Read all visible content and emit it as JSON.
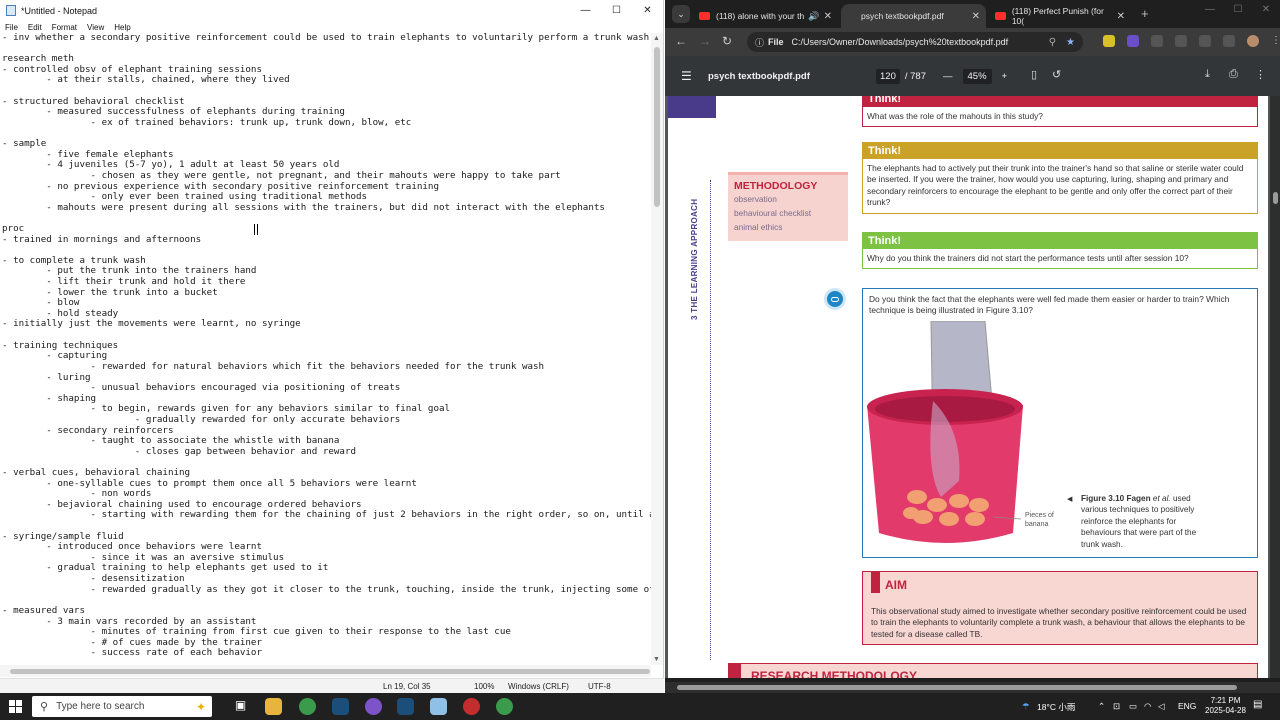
{
  "notepad": {
    "title": "*Untitled - Notepad",
    "menu": [
      "File",
      "Edit",
      "Format",
      "View",
      "Help"
    ],
    "lines": [
      "- inv whether a secondary positive reinforcement could be used to train elephants to voluntarily perform a trunk wash",
      "",
      "research meth",
      "- controlled obsv of elephant training sessions",
      "        - at their stalls, chained, where they lived",
      "",
      "- structured behavioral checklist",
      "        - measured successfulness of elephants during training",
      "                - ex of trained behaviors: trunk up, trunk down, blow, etc",
      "",
      "- sample",
      "        - five female elephants",
      "        - 4 juveniles (5-7 yo), 1 adult at least 50 years old",
      "                - chosen as they were gentle, not pregnant, and their mahouts were happy to take part",
      "        - no previous experience with secondary positive reinforcement training",
      "                - only ever been trained using traditional methods",
      "        - mahouts were present during all sessions with the trainers, but did not interact with the elephants",
      "",
      "proc",
      "- trained in mornings and afternoons",
      "",
      "- to complete a trunk wash",
      "        - put the trunk into the trainers hand",
      "        - lift their trunk and hold it there",
      "        - lower the trunk into a bucket",
      "        - blow",
      "        - hold steady",
      "- initially just the movements were learnt, no syringe",
      "",
      "- training techniques",
      "        - capturing",
      "                - rewarded for natural behaviors which fit the behaviors needed for the trunk wash",
      "        - luring",
      "                - unusual behaviors encouraged via positioning of treats",
      "        - shaping",
      "                - to begin, rewards given for any behaviors similar to final goal",
      "                        - gradually rewarded for only accurate behaviors",
      "        - secondary reinforcers",
      "                - taught to associate the whistle with banana",
      "                        - closes gap between behavior and reward",
      "",
      "- verbal cues, behavioral chaining",
      "        - one-syllable cues to prompt them once all 5 behaviors were learnt",
      "                - non words",
      "        - bejavioral chaining used to encourage ordered behaviors",
      "                - starting with rewarding them for the chaining of just 2 behaviors in the right order, so on, until all 5",
      "",
      "- syringe/sample fluid",
      "        - introduced once behaviors were learnt",
      "                - since it was an aversive stimulus",
      "        - gradual training to help elephants get used to it",
      "                - desensitization",
      "                - rewarded gradually as they got it closer to the trunk, touching, inside the trunk, injecting some of the",
      "",
      "- measured vars",
      "        - 3 main vars recorded by an assistant",
      "                - minutes of training from first cue given to their response to the last cue",
      "                - # of cues made by the trainer",
      "                - success rate of each behavior"
    ],
    "status": {
      "position": "Ln 19, Col 35",
      "zoom": "100%",
      "eol": "Windows (CRLF)",
      "encoding": "UTF-8"
    }
  },
  "browser": {
    "tabs": [
      {
        "title": "(118) alone with your th"
      },
      {
        "title": "psych textbookpdf.pdf"
      },
      {
        "title": "(118) Perfect Punish (for 10("
      }
    ],
    "address": {
      "scheme_label": "File",
      "url": "C:/Users/Owner/Downloads/psych%20textbookpdf.pdf"
    },
    "pdf": {
      "filename": "psych textbookpdf.pdf",
      "page_current": "120",
      "page_total": "/ 787",
      "zoom": "45%"
    }
  },
  "page": {
    "side_title": "3 THE LEARNING APPROACH",
    "think1": {
      "head": "Think!",
      "body": "What was the role of the mahouts in this study?"
    },
    "think2": {
      "head": "Think!",
      "body": "The elephants had to actively put their trunk into the trainer's hand so that saline or sterile water could be inserted. If you were the trainer, how would you use capturing, luring, shaping and primary and secondary reinforcers to encourage the elephant to be gentle and only offer the correct part of their trunk?"
    },
    "think3": {
      "head": "Think!",
      "body": "Why do you think the trainers did not start the performance tests until after session 10?"
    },
    "methodology": {
      "title": "METHODOLOGY",
      "items": [
        "observation",
        "behavioural checklist",
        "animal ethics"
      ]
    },
    "question": "Do you think the fact that the elephants were well fed made them easier or harder to train? Which technique is being illustrated in Figure 3.10?",
    "caption": {
      "ref": "Figure 3.10 Fagen",
      "etal": "et al.",
      "text": "used various techniques to positively reinforce the elephants for behaviours that were part of the trunk wash."
    },
    "banana_label": "Pieces of banana",
    "aim": {
      "head": "AIM",
      "body": "This observational study aimed to investigate whether secondary positive reinforcement could be used to train the elephants to voluntarily complete a trunk wash, a behaviour that allows the elephants to be tested for a disease called TB."
    },
    "research": {
      "head": "RESEARCH METHODOLOGY"
    }
  },
  "taskbar": {
    "search_placeholder": "Type here to search",
    "weather": "18°C 小雨",
    "lang": "ENG",
    "time": "7:21 PM",
    "date": "2025-04-28"
  }
}
